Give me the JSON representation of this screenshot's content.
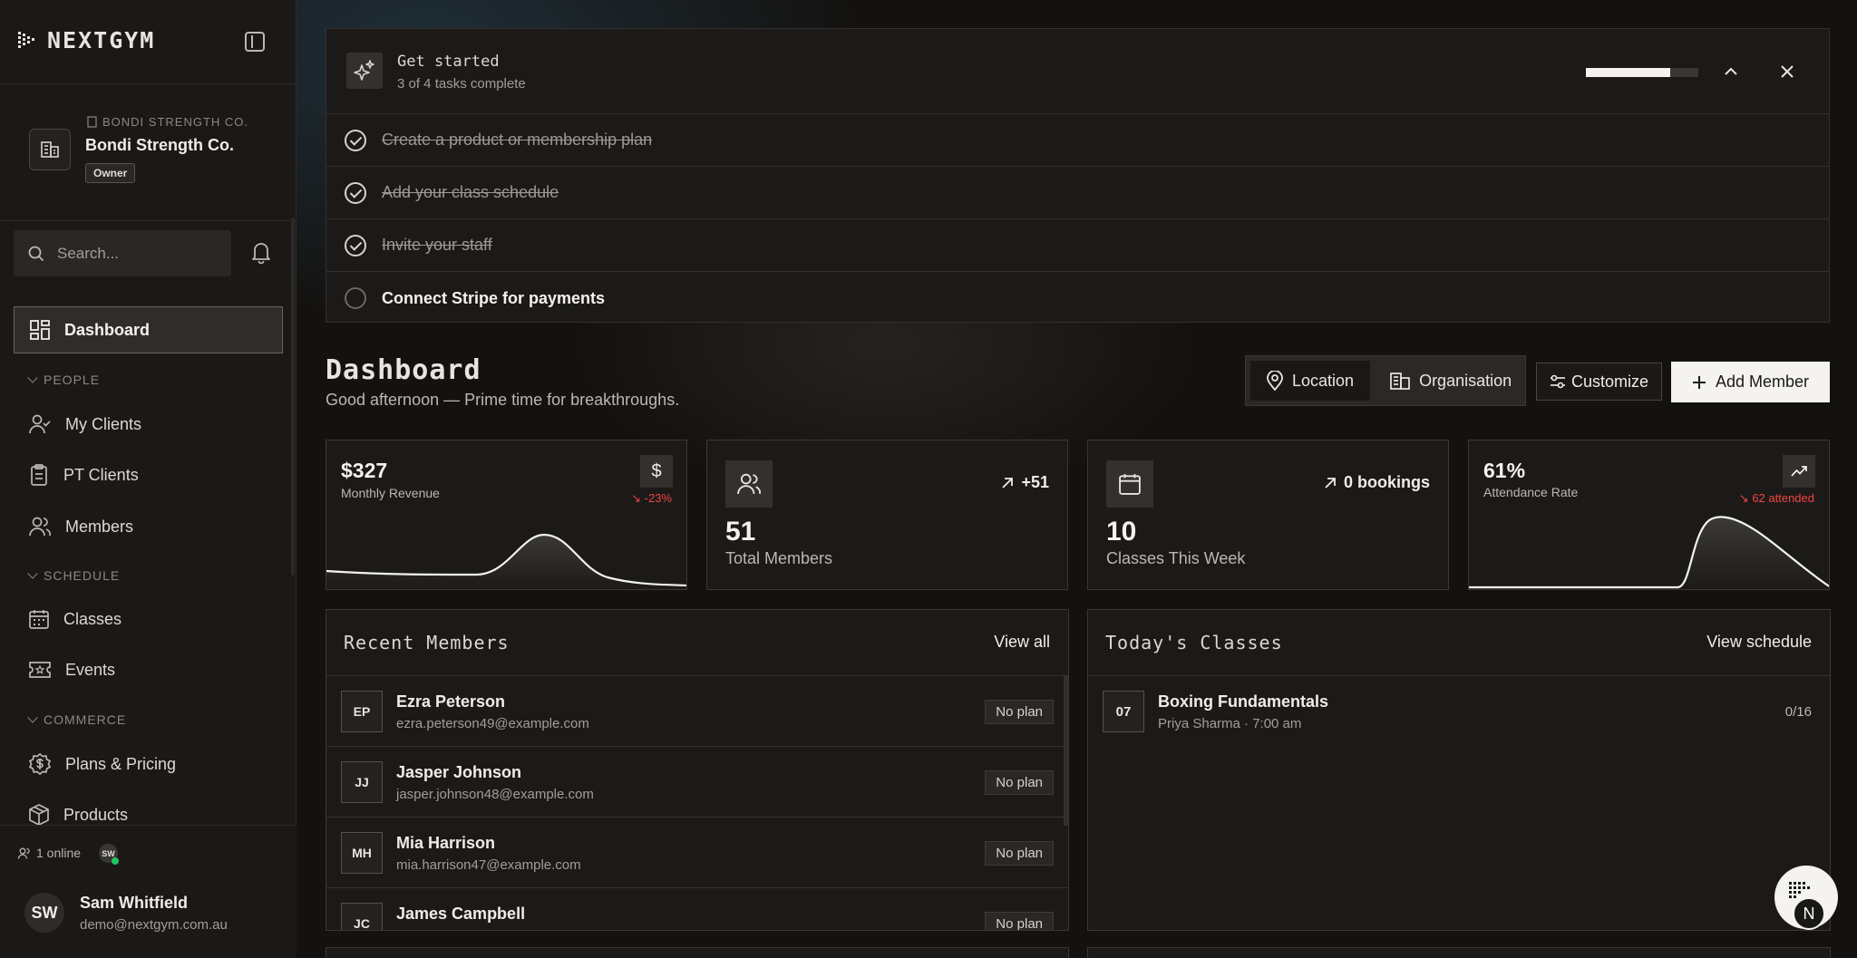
{
  "app": {
    "logo_text": "NEXTGYM"
  },
  "org": {
    "small_label": "BONDI STRENGTH CO.",
    "name": "Bondi Strength Co.",
    "role": "Owner"
  },
  "search": {
    "placeholder": "Search..."
  },
  "nav": {
    "dashboard": "Dashboard",
    "sections": {
      "people": "PEOPLE",
      "schedule": "SCHEDULE",
      "commerce": "COMMERCE"
    },
    "items": {
      "my_clients": "My Clients",
      "pt_clients": "PT Clients",
      "members": "Members",
      "classes": "Classes",
      "events": "Events",
      "plans": "Plans & Pricing",
      "products": "Products"
    }
  },
  "presence": {
    "online": "1 online",
    "avatar": "SW"
  },
  "user": {
    "initials": "SW",
    "name": "Sam Whitfield",
    "email": "demo@nextgym.com.au"
  },
  "get_started": {
    "title": "Get started",
    "subtitle": "3 of 4 tasks complete",
    "progress": 0.75,
    "tasks": [
      {
        "label": "Create a product or membership plan",
        "done": true
      },
      {
        "label": "Add your class schedule",
        "done": true
      },
      {
        "label": "Invite your staff",
        "done": true
      },
      {
        "label": "Connect Stripe for payments",
        "done": false
      }
    ]
  },
  "dashboard": {
    "title": "Dashboard",
    "greeting": "Good afternoon — Prime time for breakthroughs.",
    "scope": {
      "location": "Location",
      "organisation": "Organisation",
      "active": "location"
    },
    "customize": "Customize",
    "add_member": "Add Member"
  },
  "stats": {
    "revenue": {
      "value": "$327",
      "label": "Monthly Revenue",
      "icon": "$",
      "delta": "-23%"
    },
    "members": {
      "value": "51",
      "label": "Total Members",
      "delta": "+51"
    },
    "classes": {
      "value": "10",
      "label": "Classes This Week",
      "delta": "0 bookings"
    },
    "attendance": {
      "value": "61%",
      "label": "Attendance Rate",
      "delta": "62 attended"
    }
  },
  "recent_members": {
    "title": "Recent Members",
    "link": "View all",
    "rows": [
      {
        "initials": "EP",
        "name": "Ezra Peterson",
        "email": "ezra.peterson49@example.com",
        "plan": "No plan"
      },
      {
        "initials": "JJ",
        "name": "Jasper Johnson",
        "email": "jasper.johnson48@example.com",
        "plan": "No plan"
      },
      {
        "initials": "MH",
        "name": "Mia Harrison",
        "email": "mia.harrison47@example.com",
        "plan": "No plan"
      },
      {
        "initials": "JC",
        "name": "James Campbell",
        "email": "",
        "plan": "No plan"
      }
    ]
  },
  "todays_classes": {
    "title": "Today's Classes",
    "link": "View schedule",
    "rows": [
      {
        "day": "07",
        "name": "Boxing Fundamentals",
        "meta": "Priya Sharma · 7:00 am",
        "capacity": "0/16"
      }
    ]
  },
  "fab": {
    "letter": "N"
  },
  "colors": {
    "accent": "#f5f3f0",
    "negative": "#ef4444",
    "online": "#22c55e",
    "background": "#141210"
  }
}
